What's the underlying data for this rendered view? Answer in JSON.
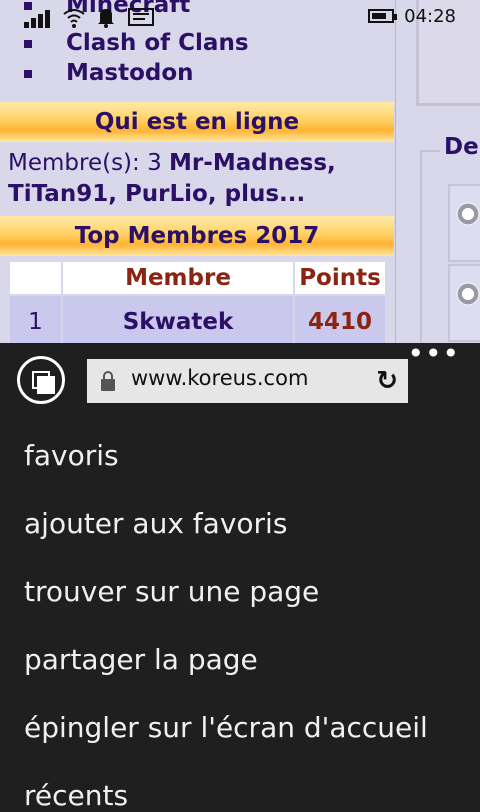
{
  "status_bar": {
    "time": "04:28",
    "icons": [
      "signal-icon",
      "wifi-icon",
      "notification-icon",
      "message-icon",
      "battery-icon"
    ]
  },
  "web": {
    "games": [
      "Minecraft",
      "Clash of Clans",
      "Mastodon"
    ],
    "online_header": "Qui est en ligne",
    "members_prefix": "Membre(s): 3 ",
    "members_names": "Mr-Madness, TiTan91, PurLio, plus...",
    "top_header": "Top Membres 2017",
    "table": {
      "headers": [
        "",
        "Membre",
        "Points"
      ],
      "rows": [
        [
          "1",
          "Skwatek",
          "4410"
        ]
      ]
    },
    "right_legend": "De"
  },
  "browser": {
    "url": "www.koreus.com",
    "menu_items": [
      "favoris",
      "ajouter aux favoris",
      "trouver sur une page",
      "partager la page",
      "épingler sur l'écran d'accueil",
      "récents"
    ]
  }
}
